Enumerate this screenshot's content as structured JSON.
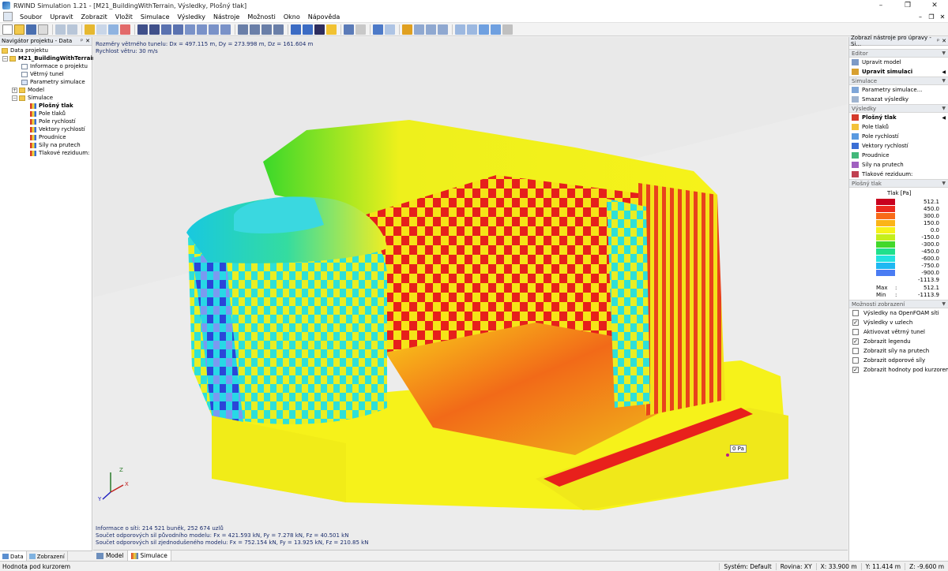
{
  "window": {
    "title": "RWIND Simulation 1.21 - [M21_BuildingWithTerrain, Výsledky, Plošný tlak]",
    "min": "–",
    "max": "❐",
    "close": "✕"
  },
  "menu": [
    "Soubor",
    "Upravit",
    "Zobrazit",
    "Vložit",
    "Simulace",
    "Výsledky",
    "Nástroje",
    "Možnosti",
    "Okno",
    "Nápověda"
  ],
  "menu_right": [
    "–",
    "❐",
    "✕"
  ],
  "navigator": {
    "title": "Navigátor projektu - Data",
    "pin": "ᵖ",
    "close": "✕",
    "root": "Data projektu",
    "project": "M21_BuildingWithTerrain",
    "items": [
      "Informace o projektu",
      "Větrný tunel",
      "Parametry simulace",
      "Model",
      "Simulace"
    ],
    "sim_items": [
      "Plošný tlak",
      "Pole tlaků",
      "Pole rychlostí",
      "Vektory rychlostí",
      "Proudnice",
      "Síly na prutech",
      "Tlakové reziduum:"
    ],
    "tabs": [
      "Data",
      "Zobrazení"
    ]
  },
  "viewport": {
    "info1": "Rozměry větrného tunelu: Dx = 497.115 m, Dy = 273.998 m, Dz = 161.604 m",
    "info2": "Rychlost větru: 30 m/s",
    "probe": "0 Pa",
    "axis_x": "X",
    "axis_y": "Y",
    "axis_z": "Z",
    "footer1": "Informace o síti: 214 521 buněk, 252 674 uzlů",
    "footer2": "Součet odporových sil původního modelu: Fx = 421.593 kN, Fy = 7.278 kN, Fz = 40.501 kN",
    "footer3": "Součet odporových sil zjednodušeného modelu: Fx = 752.154 kN, Fy = 13.925 kN, Fz = 210.85 kN"
  },
  "bottom_tabs": [
    "Model",
    "Simulace"
  ],
  "right_panel": {
    "title": "Zobrazí nástroje pro úpravy - Si...",
    "pin": "ᵖ",
    "close": "✕",
    "editor_header": "Editor",
    "editor_items": [
      "Upravit model",
      "Upravit simulaci"
    ],
    "sim_header": "Simulace",
    "sim_items": [
      "Parametry simulace...",
      "Smazat výsledky"
    ],
    "results_header": "Výsledky",
    "results_items": [
      "Plošný tlak",
      "Pole tlaků",
      "Pole rychlostí",
      "Vektory rychlostí",
      "Proudnice",
      "Síly na prutech",
      "Tlakové reziduum:"
    ],
    "legend_header": "Plošný tlak",
    "legend_title": "Tlak [Pa]",
    "legend_values": [
      "512.1",
      "450.0",
      "300.0",
      "150.0",
      "0.0",
      "-150.0",
      "-300.0",
      "-450.0",
      "-600.0",
      "-750.0",
      "-900.0",
      "-1113.9"
    ],
    "legend_colors": [
      "#c8001e",
      "#ec2a1e",
      "#f86a18",
      "#fbb418",
      "#f6f21a",
      "#c5ef1c",
      "#42d82a",
      "#20e08c",
      "#22e3e0",
      "#1fb8f2",
      "#4a7cf3",
      "#1414c8"
    ],
    "max_label": "Max",
    "min_label": "Min",
    "colon": ":",
    "max_value": "512.1",
    "min_value": "-1113.9",
    "options_header": "Možnosti zobrazení",
    "options": [
      {
        "label": "Výsledky na OpenFOAM síti",
        "checked": false
      },
      {
        "label": "Výsledky v uzlech",
        "checked": true
      },
      {
        "label": "Aktivovat větrný tunel",
        "checked": false
      },
      {
        "label": "Zobrazit legendu",
        "checked": true
      },
      {
        "label": "Zobrazit síly na prutech",
        "checked": false
      },
      {
        "label": "Zobrazit odporové síly",
        "checked": false
      },
      {
        "label": "Zobrazit hodnoty pod kurzorem",
        "checked": true
      }
    ],
    "check_mark": "✓"
  },
  "status": {
    "left": "Hodnota pod kurzorem",
    "system": "Systém: Default",
    "plane": "Rovina: XY",
    "x": "X:  33.900 m",
    "y": "Y:  11.414 m",
    "z": "Z:  -9.600 m"
  },
  "colors": {
    "accent": "#1e5fb4",
    "pressure_high": "#e8141c",
    "pressure_zero": "#f6f21a",
    "pressure_low": "#1414c8"
  }
}
